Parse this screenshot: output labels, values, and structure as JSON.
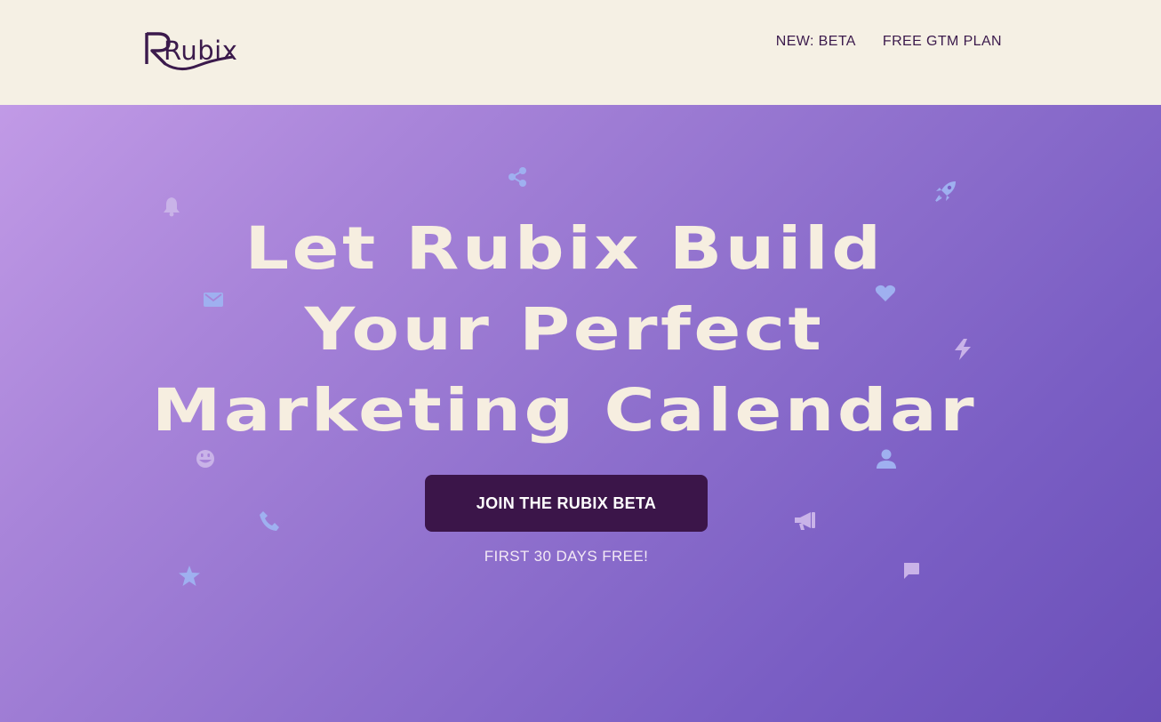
{
  "header": {
    "logo_text": "Rubix",
    "nav": [
      {
        "label": "NEW: BETA"
      },
      {
        "label": "FREE GTM PLAN"
      }
    ]
  },
  "hero": {
    "title_lines": [
      "Let Rubix Build",
      "Your Perfect",
      "Marketing Calendar"
    ],
    "cta_label": "JOIN THE RUBIX BETA",
    "subtext": "FIRST 30 DAYS FREE!"
  },
  "colors": {
    "brand_dark": "#3b1a4c",
    "cream": "#f5f0e4",
    "gradient_start": "#c19ae6",
    "gradient_end": "#6a4fb8",
    "icon_blue": "#9fb0f0",
    "icon_lavender": "#c9b3e8"
  },
  "decor_icons": [
    "share-icon",
    "bell-icon",
    "rocket-icon",
    "mail-icon",
    "heart-icon",
    "lightning-icon",
    "smiley-icon",
    "user-icon",
    "phone-icon",
    "megaphone-icon",
    "star-icon",
    "chat-icon"
  ]
}
